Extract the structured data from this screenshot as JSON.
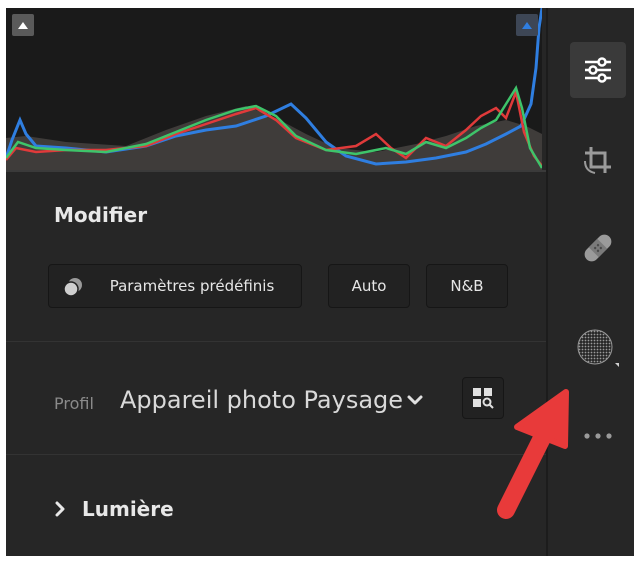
{
  "panel": {
    "title": "Modifier",
    "buttons": {
      "presets_label": "Paramètres prédéfinis",
      "auto_label": "Auto",
      "bw_label": "N&B"
    },
    "profile": {
      "label": "Profil",
      "value": "Appareil photo Paysage"
    },
    "sections": [
      {
        "label": "Lumière",
        "expanded": false
      }
    ]
  },
  "histogram": {
    "channels": [
      "red",
      "green",
      "blue"
    ],
    "shadow_clipping_warning": false,
    "highlight_clipping_warning": true
  },
  "toolbar": {
    "items": [
      {
        "icon": "sliders-icon",
        "active": true
      },
      {
        "icon": "crop-rotate-icon",
        "active": false
      },
      {
        "icon": "healing-bandage-icon",
        "active": false
      },
      {
        "icon": "masking-circle-icon",
        "active": false
      },
      {
        "icon": "more-dots-icon",
        "active": false
      }
    ]
  },
  "colors": {
    "panel_bg": "#262626",
    "histogram_bg": "#1a1a1a",
    "text": "#e8e8e8",
    "muted_text": "#8a8a8a",
    "accent_blue": "#2f7ee0",
    "annotation_arrow": "#e83a3a"
  }
}
